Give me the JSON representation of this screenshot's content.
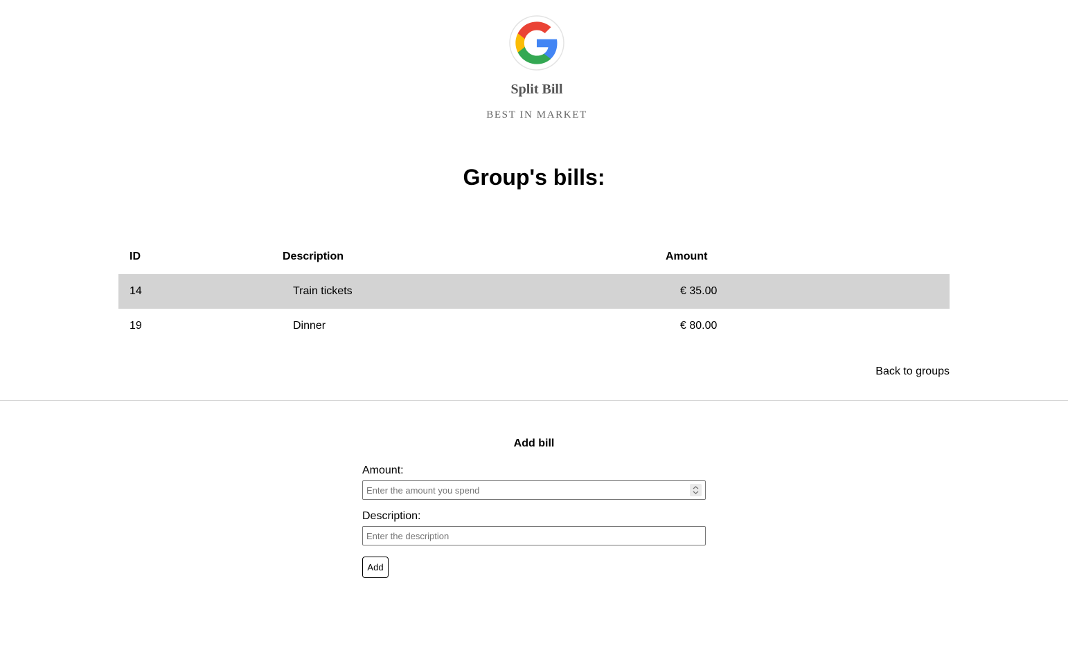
{
  "brand": {
    "name": "Split Bill",
    "tagline": "BEST IN MARKET",
    "logo_icon": "google-g-icon"
  },
  "page": {
    "title": "Group's bills:"
  },
  "table": {
    "headers": {
      "id": "ID",
      "description": "Description",
      "amount": "Amount"
    },
    "rows": [
      {
        "id": "14",
        "description": "Train tickets",
        "amount": "€ 35.00"
      },
      {
        "id": "19",
        "description": "Dinner",
        "amount": "€ 80.00"
      }
    ],
    "highlight_color": "#d3d3d3"
  },
  "nav": {
    "back_label": "Back to groups"
  },
  "form": {
    "title": "Add bill",
    "amount_label": "Amount:",
    "amount_placeholder": "Enter the amount you spend",
    "amount_value": "",
    "description_label": "Description:",
    "description_placeholder": "Enter the description",
    "description_value": "",
    "submit_label": "Add"
  }
}
